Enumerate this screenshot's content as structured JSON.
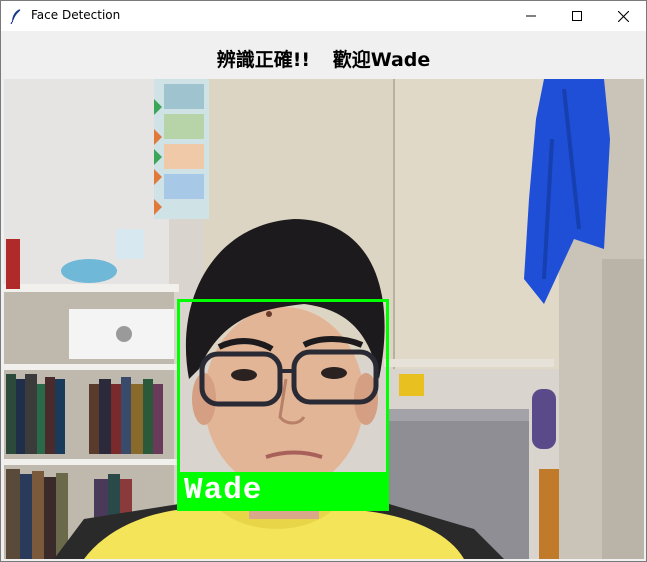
{
  "window": {
    "title": "Face Detection",
    "controls": {
      "minimize": "minimize",
      "maximize": "maximize",
      "close": "close"
    }
  },
  "status": {
    "message": "辨識正確!!",
    "greeting": "歡迎Wade"
  },
  "detection": {
    "label": "Wade",
    "box_color": "#00ff00",
    "label_text_color": "#ffffff"
  },
  "icons": {
    "app": "feather-icon",
    "minimize": "minimize-icon",
    "maximize": "maximize-icon",
    "close": "close-icon"
  }
}
